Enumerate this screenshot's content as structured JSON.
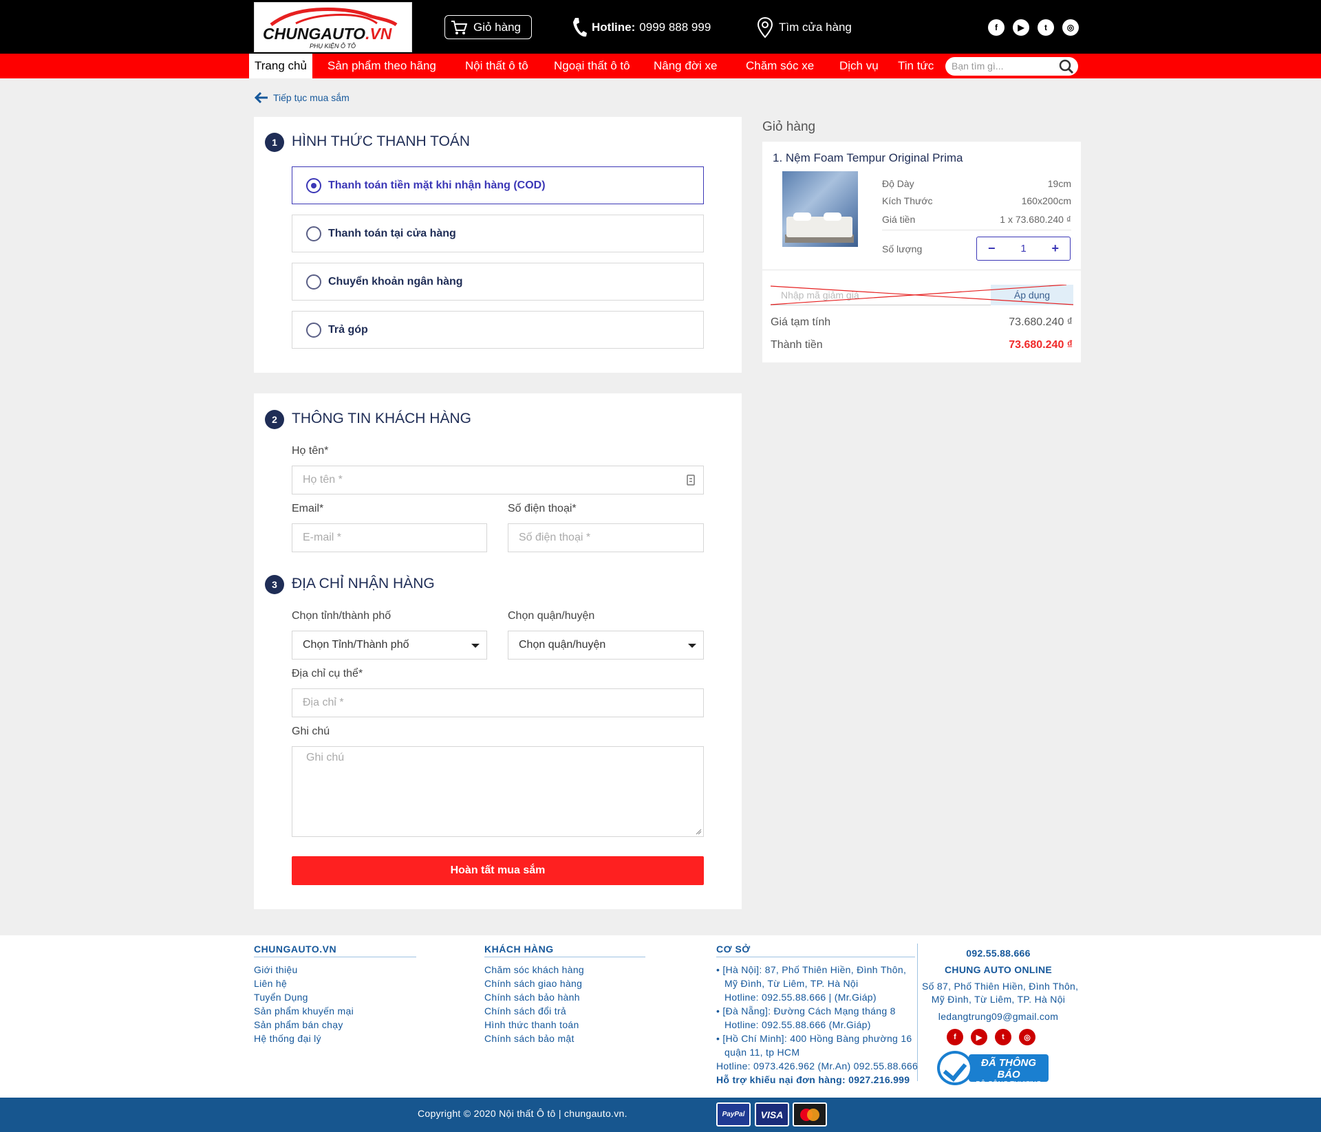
{
  "header": {
    "logo_brand": "CHUNGAUTO",
    "logo_tld": ".VN",
    "logo_tagline": "PHỤ KIỆN Ô TÔ",
    "cart_label": "Giỏ hàng",
    "hotline_label": "Hotline:",
    "hotline_number": "0999 888 999",
    "store_label": "Tìm cửa hàng",
    "social_icons": [
      "facebook-icon",
      "youtube-icon",
      "twitter-icon",
      "instagram-icon"
    ]
  },
  "nav": {
    "items": [
      "Trang chủ",
      "Sản phẩm theo hãng",
      "Nội thất ô tô",
      "Ngoại thất ô tô",
      "Nâng đời xe",
      "Chăm sóc xe",
      "Dịch vụ",
      "Tin tức"
    ],
    "active_index": 0,
    "search_placeholder": "Bạn tìm gì..."
  },
  "back_link": "Tiếp tục mua sắm",
  "payment": {
    "step": "1",
    "title": "HÌNH THỨC THANH TOÁN",
    "options": [
      {
        "label": "Thanh toán tiền mặt khi nhận hàng",
        "suffix": "(COD)",
        "selected": true
      },
      {
        "label": "Thanh toán tại cửa hàng",
        "selected": false
      },
      {
        "label": "Chuyển khoản ngân hàng",
        "selected": false
      },
      {
        "label": "Trả góp",
        "selected": false
      }
    ]
  },
  "customer": {
    "step": "2",
    "title": "THÔNG TIN KHÁCH HÀNG",
    "name_label": "Họ tên*",
    "name_placeholder": "Họ tên *",
    "email_label": "Email*",
    "email_placeholder": "E-mail *",
    "phone_label": "Số điện thoại*",
    "phone_placeholder": "Số điện thoại *"
  },
  "address": {
    "step": "3",
    "title": "ĐỊA CHỈ NHẬN HÀNG",
    "city_label": "Chọn tỉnh/thành phố",
    "city_value": "Chọn Tỉnh/Thành phố",
    "district_label": "Chọn quận/huyện",
    "district_value": "Chọn quận/huyện",
    "street_label": "Địa chỉ cụ thể*",
    "street_placeholder": "Địa chỉ *",
    "note_label": "Ghi chú",
    "note_placeholder": "Ghi chú",
    "submit_label": "Hoàn tất mua sắm"
  },
  "cart": {
    "heading": "Giỏ hàng",
    "product_name": "1. Nệm Foam Tempur Original Prima",
    "specs": [
      {
        "label": "Độ Dày",
        "value": "19cm"
      },
      {
        "label": "Kích Thước",
        "value": "160x200cm"
      },
      {
        "label": "Giá tiền",
        "value": "1 x 73.680.240 ₫"
      }
    ],
    "qty_label": "Số lượng",
    "qty_minus": "−",
    "qty_value": "1",
    "qty_plus": "+",
    "coupon_placeholder": "Nhập mã giảm giá",
    "coupon_button": "Áp dụng",
    "subtotal_label": "Giá tạm tính",
    "subtotal_value": "73.680.240 ₫",
    "total_label": "Thành tiền",
    "total_value": "73.680.240 ₫"
  },
  "footer": {
    "col1_title": "CHUNGAUTO.VN",
    "col1_links": [
      "Giới thiệu",
      "Liên hệ",
      "Tuyển Dụng",
      "Sản phẩm khuyến mại",
      "Sản phẩm bán chạy",
      "Hệ thống đại lý"
    ],
    "col2_title": "KHÁCH HÀNG",
    "col2_links": [
      "Chăm sóc khách hàng",
      "Chính sách giao hàng",
      "Chính sách bảo hành",
      "Chính sách đổi trả",
      "Hình thức thanh toán",
      "Chính sách bảo mật"
    ],
    "col3_title": "CƠ SỞ",
    "col3_lines": [
      "• [Hà Nội]: 87, Phố Thiên Hiền, Đình Thôn,",
      "Mỹ Đình, Từ Liêm, TP. Hà Nội",
      "Hotline: 092.55.88.666 | (Mr.Giáp)",
      "• [Đà Nẵng]: Đường Cách Mạng tháng 8",
      "Hotline: 092.55.88.666 (Mr.Giáp)",
      "• [Hồ Chí Minh]: 400 Hồng Bàng phường 16",
      "quận 11, tp HCM",
      "Hotline: 0973.426.962 (Mr.An) 092.55.88.666",
      "Hỗ trợ khiếu nại đơn hàng: 0927.216.999"
    ],
    "right_phone": "092.55.88.666",
    "right_name": "CHUNG AUTO ONLINE",
    "right_addr1": "Số 87, Phố Thiên Hiền, Đình Thôn,",
    "right_addr2": "Mỹ Đình, Từ Liêm, TP. Hà Nội",
    "right_email": "ledangtrung09@gmail.com",
    "badge_line1": "ĐÃ THÔNG BÁO",
    "badge_line2": "BỘ CÔNG THƯƠNG",
    "copyright": "Copyright © 2020 Nội thất Ô tô | chungauto.vn.",
    "payment_cards": [
      "PayPal",
      "VISA",
      "mastercard-icon"
    ]
  },
  "colors": {
    "topbar": "#000000",
    "nav_red": "#fe0000",
    "navy": "#1f2d56",
    "accent_purple": "#3b37b6",
    "submit_red": "#fe2020",
    "footer_blue": "#17568f"
  }
}
